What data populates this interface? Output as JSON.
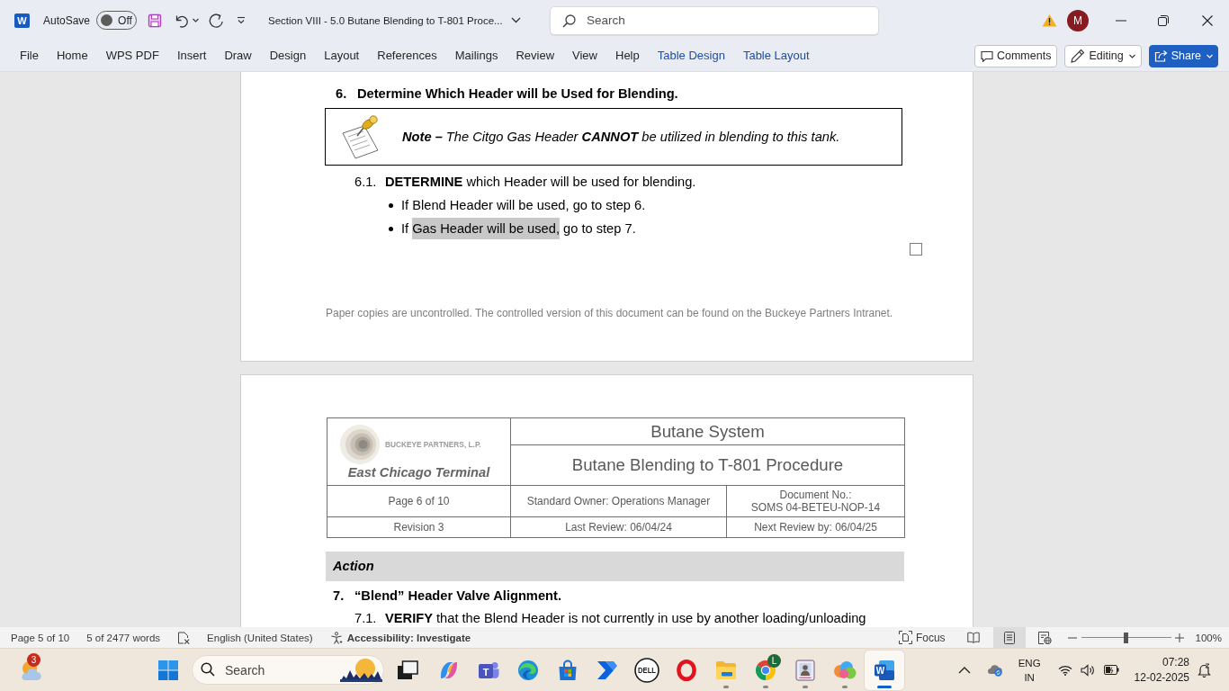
{
  "window": {
    "app_letter": "W",
    "autosave": {
      "label": "AutoSave",
      "on": false,
      "state_text": "Off"
    },
    "title": "Section VIII - 5.0 Butane Blending to T-801 Proce...",
    "search": {
      "placeholder": "Search"
    },
    "account": {
      "initial": "M"
    }
  },
  "ribbon": {
    "tabs": [
      {
        "label": "File",
        "selected": false,
        "contextual": false
      },
      {
        "label": "Home",
        "selected": false,
        "contextual": false
      },
      {
        "label": "WPS PDF",
        "selected": false,
        "contextual": false
      },
      {
        "label": "Insert",
        "selected": false,
        "contextual": false
      },
      {
        "label": "Draw",
        "selected": false,
        "contextual": false
      },
      {
        "label": "Design",
        "selected": false,
        "contextual": false
      },
      {
        "label": "Layout",
        "selected": false,
        "contextual": false
      },
      {
        "label": "References",
        "selected": false,
        "contextual": false
      },
      {
        "label": "Mailings",
        "selected": false,
        "contextual": false
      },
      {
        "label": "Review",
        "selected": false,
        "contextual": false
      },
      {
        "label": "View",
        "selected": false,
        "contextual": false
      },
      {
        "label": "Help",
        "selected": false,
        "contextual": false
      },
      {
        "label": "Table Design",
        "selected": false,
        "contextual": true
      },
      {
        "label": "Table Layout",
        "selected": false,
        "contextual": true
      }
    ],
    "comments": "Comments",
    "editing": "Editing",
    "share": "Share"
  },
  "document": {
    "page_1": {
      "heading": {
        "number": "6.",
        "text": "Determine Which Header will be Used for Blending."
      },
      "note": "**Note –** The Citgo Gas Header **CANNOT** be utilized in blending to this tank.",
      "step": {
        "number": "6.1.",
        "text": "**DETERMINE** which Header will be used for blending."
      },
      "bullets": [
        {
          "segments": [
            {
              "text": "If Blend Header will be used, go to step 6.",
              "highlighted": false
            }
          ]
        },
        {
          "segments": [
            {
              "text": "If ",
              "highlighted": false
            },
            {
              "text": "Gas Header will be used,",
              "highlighted": true
            },
            {
              "text": " go to step 7.",
              "highlighted": false
            }
          ]
        }
      ],
      "sign_off_box": {
        "checked": false
      },
      "footer": "Paper copies are uncontrolled. The controlled version of this document can be found on the Buckeye Partners Intranet."
    },
    "page_2": {
      "header_table": {
        "company": "BUCKEYE PARTNERS, L.P.",
        "site": "East Chicago Terminal",
        "system": "Butane System",
        "procedure": "Butane Blending to T-801 Procedure",
        "rows": [
          [
            "Page 6 of 10",
            "Standard Owner: Operations Manager",
            "Document No.:\nSOMS 04-BETEU-NOP-14"
          ],
          [
            "Revision 3",
            "Last Review: 06/04/24",
            "Next Review by: 06/04/25"
          ]
        ]
      },
      "action_label": "Action",
      "heading": {
        "number": "7.",
        "text": "“Blend” Header Valve Alignment."
      },
      "step": {
        "number": "7.1.",
        "text": "**VERIFY** that the Blend Header is not currently in use by another loading/unloading"
      }
    }
  },
  "status_bar": {
    "page": "Page 5 of 10",
    "words": "5 of 2477 words",
    "language": "English (United States)",
    "accessibility": "Accessibility: Investigate",
    "focus": "Focus",
    "views": [
      {
        "kind": "read",
        "selected": false
      },
      {
        "kind": "print",
        "selected": true
      },
      {
        "kind": "web",
        "selected": false
      }
    ],
    "zoom": {
      "level": 0.5,
      "reading": "100%"
    }
  },
  "taskbar": {
    "widgets": {
      "badge": "3"
    },
    "search": {
      "placeholder": "Search"
    },
    "apps": [
      {
        "kind": "taskview",
        "running": false,
        "active": false
      },
      {
        "kind": "copilot",
        "running": false,
        "active": false
      },
      {
        "kind": "teams",
        "letter": "T",
        "running": false,
        "active": false
      },
      {
        "kind": "edge",
        "running": false,
        "active": false
      },
      {
        "kind": "store",
        "running": false,
        "active": false
      },
      {
        "kind": "automate",
        "running": false,
        "active": false
      },
      {
        "kind": "dell",
        "letter": "DELL",
        "running": false,
        "active": false
      },
      {
        "kind": "opera",
        "running": false,
        "active": false
      },
      {
        "kind": "files",
        "running": true,
        "active": false
      },
      {
        "kind": "chrome",
        "badge": "L",
        "running": true,
        "active": false
      },
      {
        "kind": "frame",
        "running": true,
        "active": false
      },
      {
        "kind": "blobs",
        "running": true,
        "active": false
      },
      {
        "kind": "word",
        "letter": "W",
        "running": true,
        "active": true
      }
    ],
    "tray": {
      "language": "ENG",
      "region": "IN",
      "time": "07:28",
      "date": "12-02-2025"
    }
  }
}
